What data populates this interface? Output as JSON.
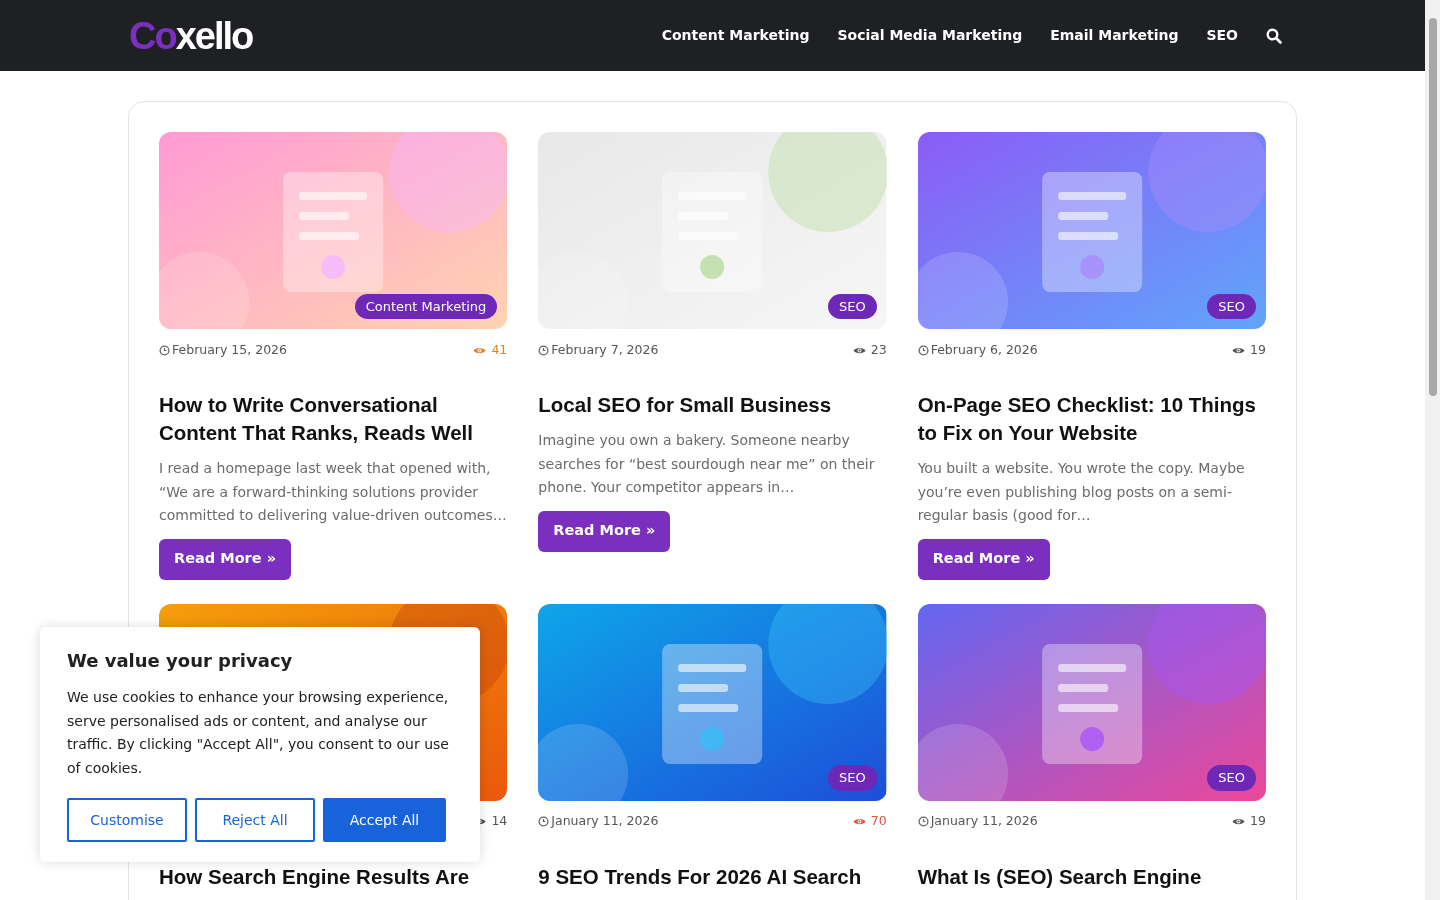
{
  "header": {
    "logo": {
      "accent": "Co",
      "rest": "xello"
    },
    "nav": [
      "Content Marketing",
      "Social Media Marketing",
      "Email Marketing",
      "SEO"
    ]
  },
  "posts": [
    {
      "category": "Content Marketing",
      "date": "February 15, 2026",
      "views": "41",
      "color": "#e67e22",
      "title": "How to Write Conversational Content That Ranks, Reads Well",
      "excerpt": "I read a homepage last week that opened with, “We are a forward-thinking solutions provider committed to delivering value-driven outcomes…",
      "button": "Read More »"
    },
    {
      "category": "SEO",
      "date": "February 7, 2026",
      "views": "23",
      "color": "#555555",
      "title": "Local SEO for Small Business",
      "excerpt": "Imagine you own a bakery. Someone nearby searches for “best sourdough near me” on their phone. Your competitor appears in…",
      "button": "Read More »"
    },
    {
      "category": "SEO",
      "date": "February 6, 2026",
      "views": "19",
      "color": "#555555",
      "title": "On-Page SEO Checklist: 10 Things to Fix on Your Website",
      "excerpt": "You built a website. You wrote the copy. Maybe you’re even publishing blog posts on a semi-regular basis (good for…",
      "button": "Read More »"
    },
    {
      "views": "14",
      "color": "#555555",
      "title": "How Search Engine Results Are"
    },
    {
      "category": "SEO",
      "date": "January 11, 2026",
      "views": "70",
      "color": "#e5533d",
      "title": "9 SEO Trends For 2026 AI Search"
    },
    {
      "category": "SEO",
      "date": "January 11, 2026",
      "views": "19",
      "color": "#555555",
      "title": "What Is (SEO) Search Engine"
    }
  ],
  "cookie_banner": {
    "title": "We value your privacy",
    "text": "We use cookies to enhance your browsing experience, serve personalised ads or content, and analyse our traffic. By clicking \"Accept All\", you consent to our use of cookies.",
    "buttons": [
      {
        "label": "Customise",
        "kind": "outline"
      },
      {
        "label": "Reject All",
        "kind": "outline"
      },
      {
        "label": "Accept All",
        "kind": "primary"
      }
    ]
  }
}
